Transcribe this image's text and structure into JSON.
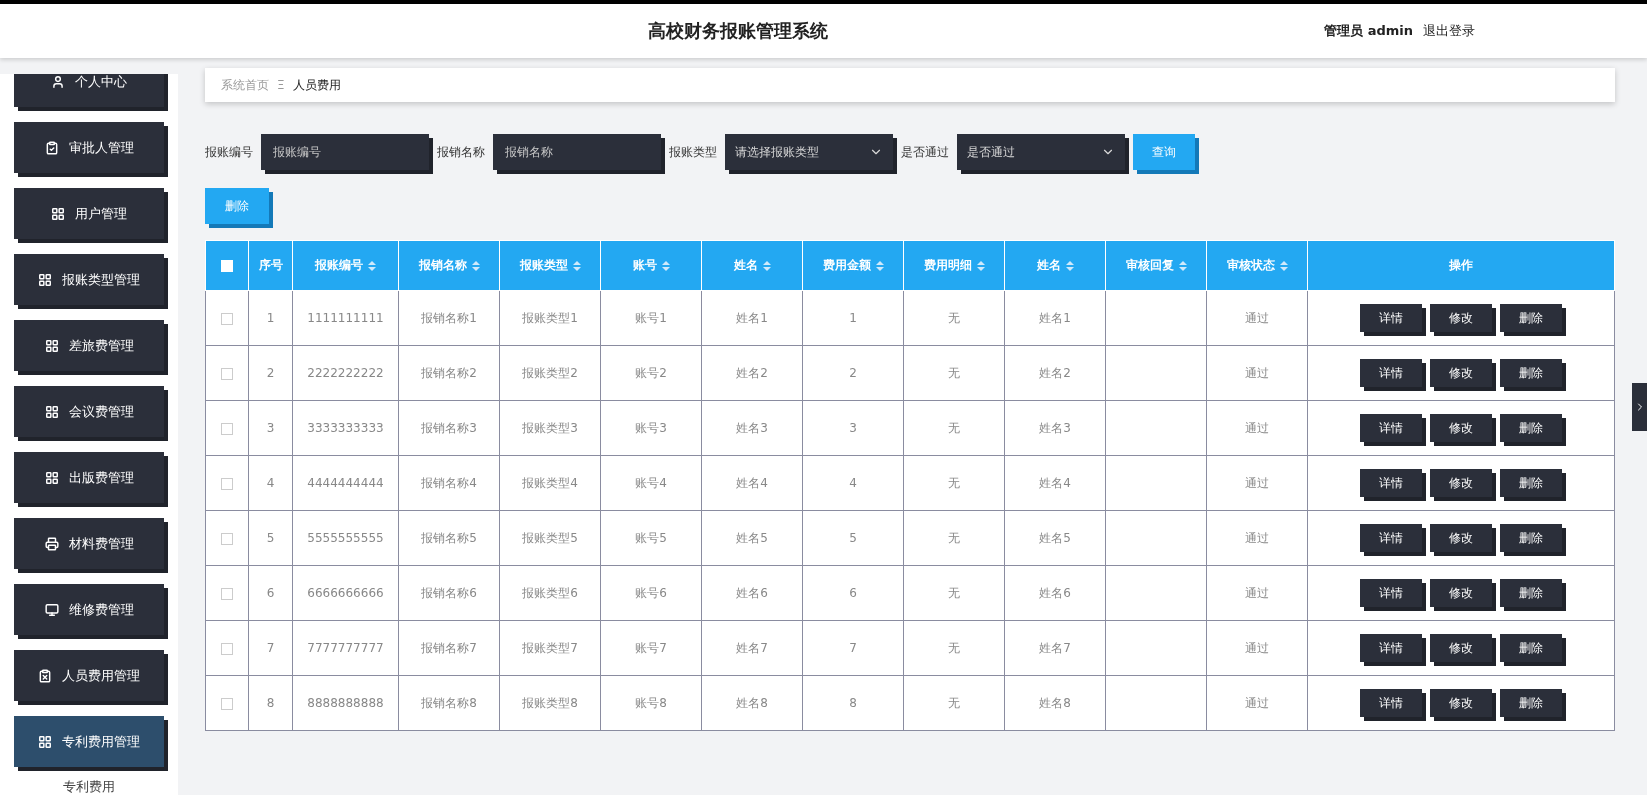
{
  "header": {
    "title": "高校财务报账管理系统",
    "user": "管理员 admin",
    "logout": "退出登录"
  },
  "sidebar": {
    "items": [
      {
        "label": "个人中心",
        "selected": false
      },
      {
        "label": "审批人管理",
        "selected": false
      },
      {
        "label": "用户管理",
        "selected": false
      },
      {
        "label": "报账类型管理",
        "selected": false
      },
      {
        "label": "差旅费管理",
        "selected": false
      },
      {
        "label": "会议费管理",
        "selected": false
      },
      {
        "label": "出版费管理",
        "selected": false
      },
      {
        "label": "材料费管理",
        "selected": false
      },
      {
        "label": "维修费管理",
        "selected": false
      },
      {
        "label": "人员费用管理",
        "selected": false
      },
      {
        "label": "专利费用管理",
        "selected": true
      }
    ],
    "submenu_item": "专利费用"
  },
  "breadcrumb": {
    "home": "系统首页",
    "separator": "Ξ",
    "current": "人员费用"
  },
  "filters": [
    {
      "kind": "input",
      "label": "报账编号",
      "placeholder": "报账编号"
    },
    {
      "kind": "input",
      "label": "报销名称",
      "placeholder": "报销名称"
    },
    {
      "kind": "select",
      "label": "报账类型",
      "placeholder": "请选择报账类型"
    },
    {
      "kind": "select",
      "label": "是否通过",
      "placeholder": "是否通过"
    }
  ],
  "search_button": "查询",
  "delete_button": "删除",
  "table": {
    "select_all_checked": false,
    "columns": [
      {
        "label": "序号",
        "sortable": false
      },
      {
        "label": "报账编号",
        "sortable": true
      },
      {
        "label": "报销名称",
        "sortable": true
      },
      {
        "label": "报账类型",
        "sortable": true
      },
      {
        "label": "账号",
        "sortable": true
      },
      {
        "label": "姓名",
        "sortable": true
      },
      {
        "label": "费用金额",
        "sortable": true
      },
      {
        "label": "费用明细",
        "sortable": true
      },
      {
        "label": "姓名",
        "sortable": true
      },
      {
        "label": "审核回复",
        "sortable": true
      },
      {
        "label": "审核状态",
        "sortable": true
      },
      {
        "label": "操作",
        "sortable": false
      }
    ],
    "rows": [
      {
        "checked": false,
        "cells": [
          "1",
          "1111111111",
          "报销名称1",
          "报账类型1",
          "账号1",
          "姓名1",
          "1",
          "无",
          "姓名1",
          "",
          "通过"
        ],
        "actions": [
          "详情",
          "修改",
          "删除"
        ]
      },
      {
        "checked": false,
        "cells": [
          "2",
          "2222222222",
          "报销名称2",
          "报账类型2",
          "账号2",
          "姓名2",
          "2",
          "无",
          "姓名2",
          "",
          "通过"
        ],
        "actions": [
          "详情",
          "修改",
          "删除"
        ]
      },
      {
        "checked": false,
        "cells": [
          "3",
          "3333333333",
          "报销名称3",
          "报账类型3",
          "账号3",
          "姓名3",
          "3",
          "无",
          "姓名3",
          "",
          "通过"
        ],
        "actions": [
          "详情",
          "修改",
          "删除"
        ]
      },
      {
        "checked": false,
        "cells": [
          "4",
          "4444444444",
          "报销名称4",
          "报账类型4",
          "账号4",
          "姓名4",
          "4",
          "无",
          "姓名4",
          "",
          "通过"
        ],
        "actions": [
          "详情",
          "修改",
          "删除"
        ]
      },
      {
        "checked": false,
        "cells": [
          "5",
          "5555555555",
          "报销名称5",
          "报账类型5",
          "账号5",
          "姓名5",
          "5",
          "无",
          "姓名5",
          "",
          "通过"
        ],
        "actions": [
          "详情",
          "修改",
          "删除"
        ]
      },
      {
        "checked": false,
        "cells": [
          "6",
          "6666666666",
          "报销名称6",
          "报账类型6",
          "账号6",
          "姓名6",
          "6",
          "无",
          "姓名6",
          "",
          "通过"
        ],
        "actions": [
          "详情",
          "修改",
          "删除"
        ]
      },
      {
        "checked": false,
        "cells": [
          "7",
          "7777777777",
          "报销名称7",
          "报账类型7",
          "账号7",
          "姓名7",
          "7",
          "无",
          "姓名7",
          "",
          "通过"
        ],
        "actions": [
          "详情",
          "修改",
          "删除"
        ]
      },
      {
        "checked": false,
        "cells": [
          "8",
          "8888888888",
          "报销名称8",
          "报账类型8",
          "账号8",
          "姓名8",
          "8",
          "无",
          "姓名8",
          "",
          "通过"
        ],
        "actions": [
          "详情",
          "修改",
          "删除"
        ]
      }
    ]
  }
}
